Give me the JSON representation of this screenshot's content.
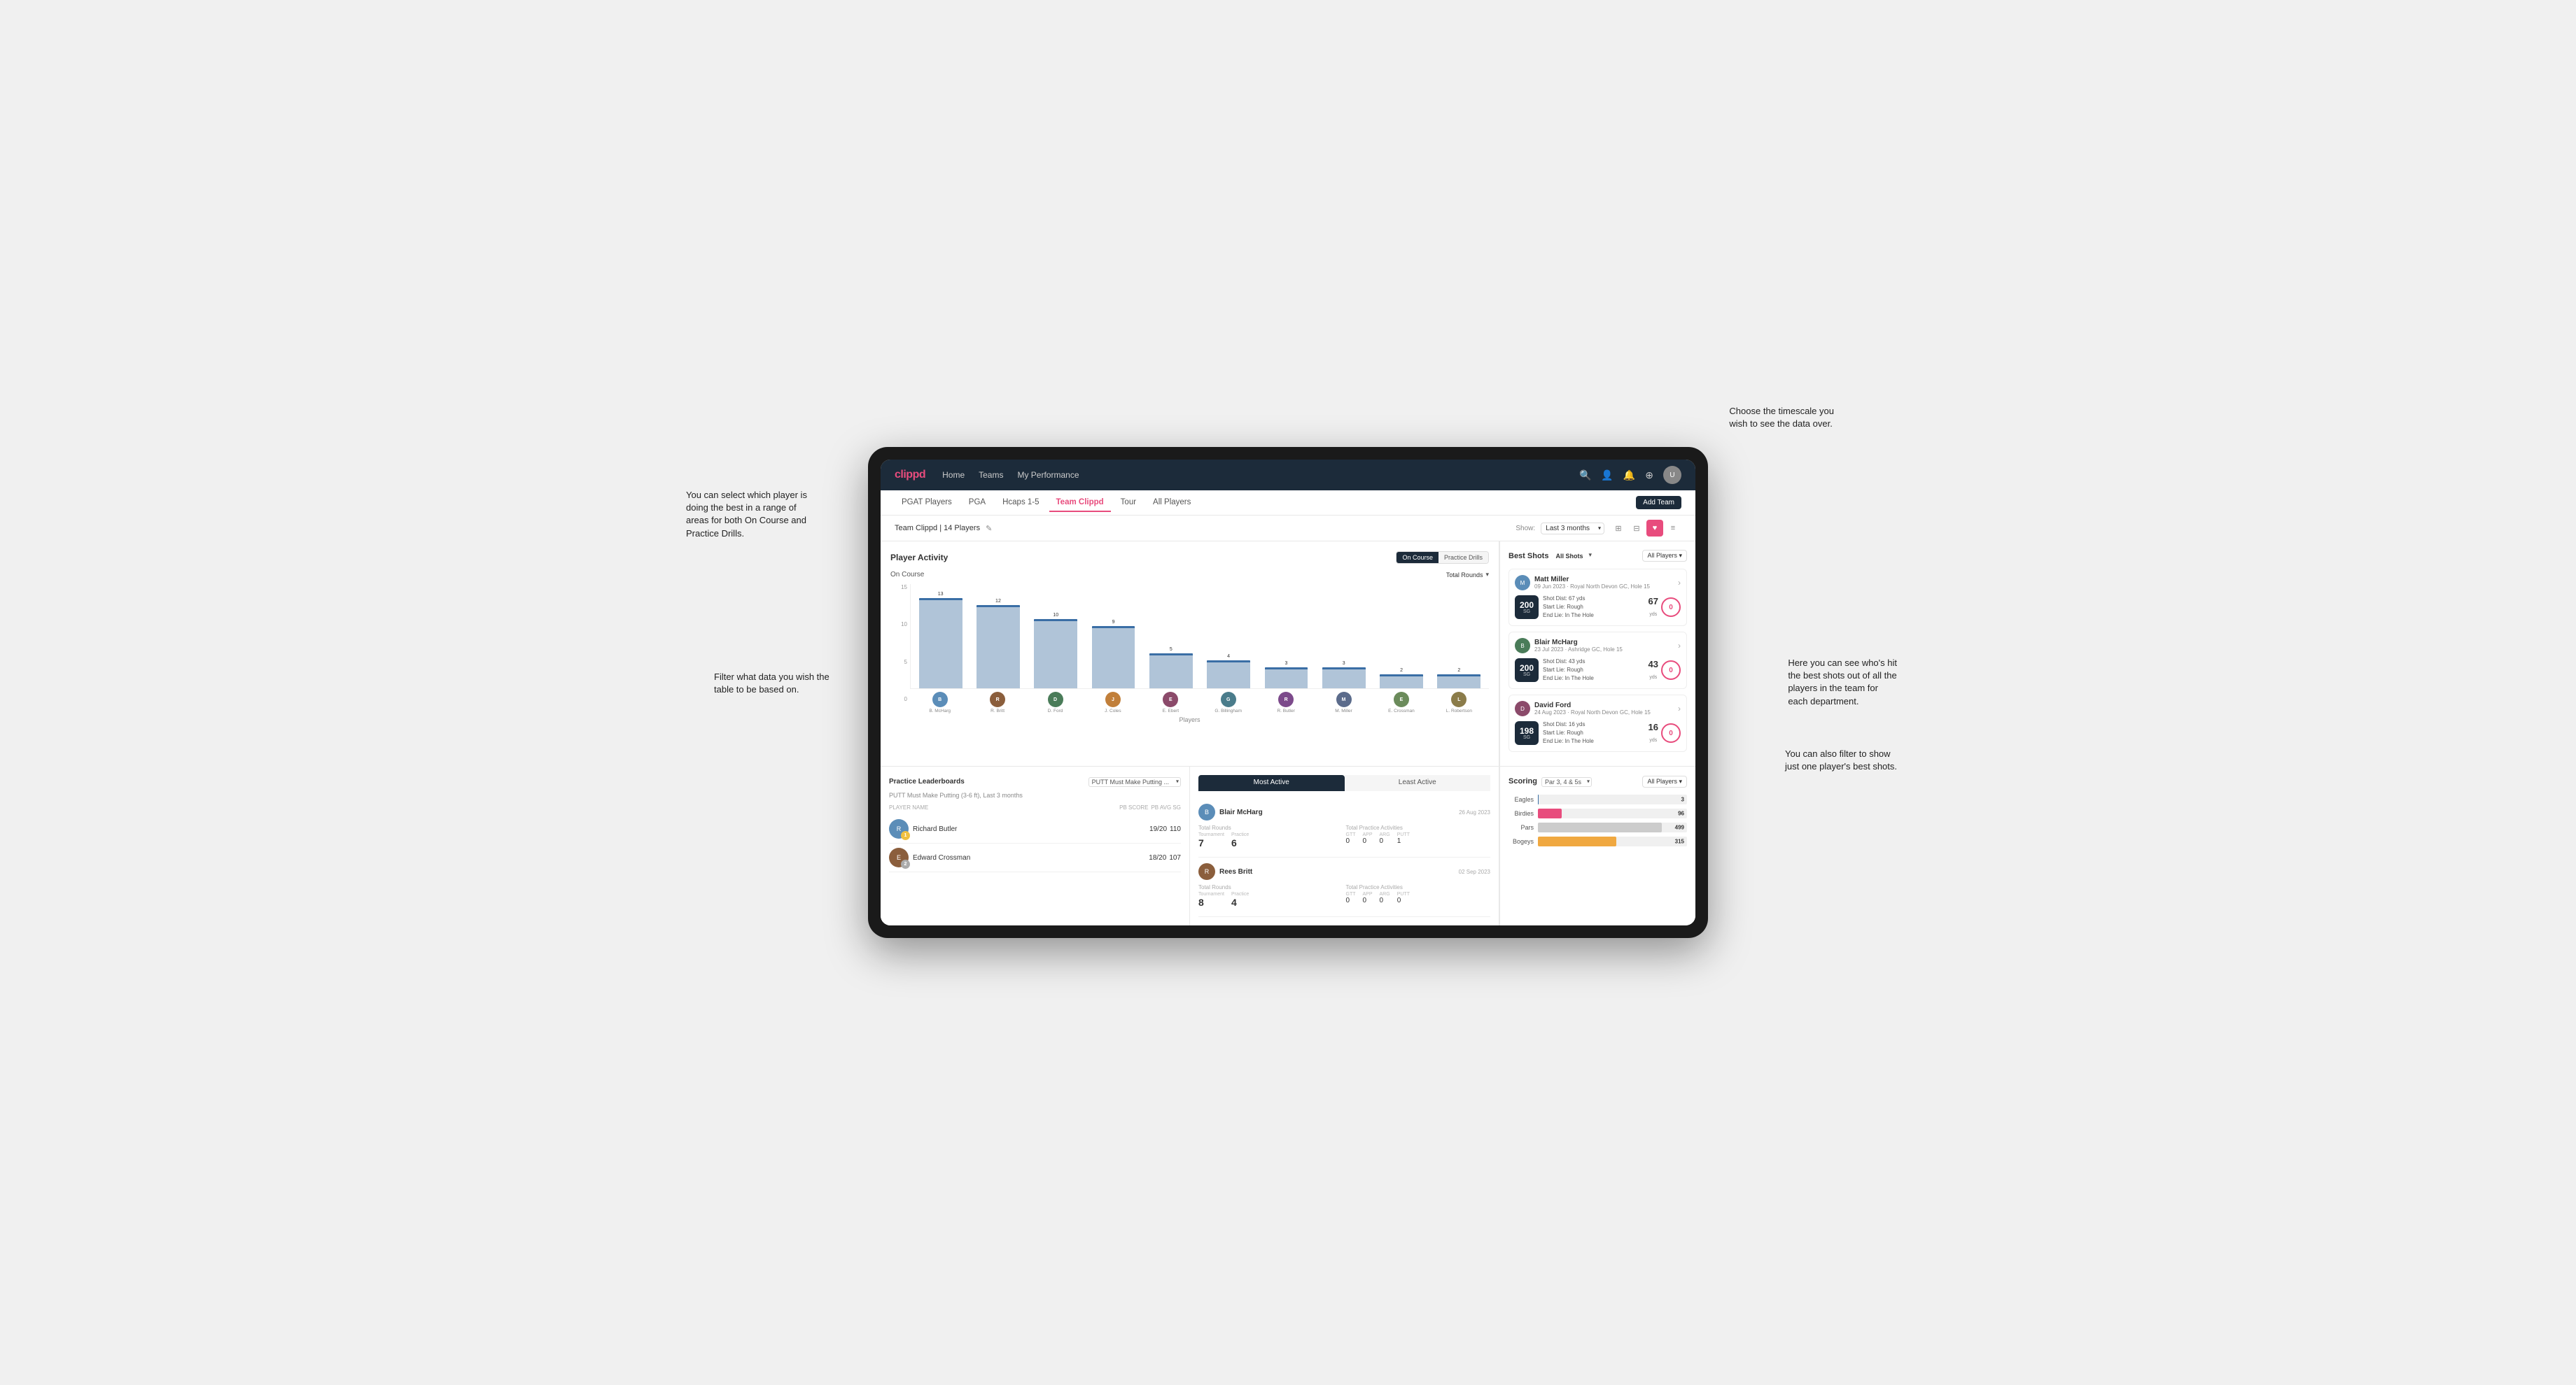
{
  "annotations": {
    "top_right": "Choose the timescale you\nwish to see the data over.",
    "left_top": "You can select which player is\ndoing the best in a range of\nareas for both On Course and\nPractice Drills.",
    "left_bottom": "Filter what data you wish the\ntable to be based on.",
    "right_mid": "Here you can see who's hit\nthe best shots out of all the\nplayers in the team for\neach department.",
    "right_bottom": "You can also filter to show\njust one player's best shots."
  },
  "navbar": {
    "brand": "clippd",
    "links": [
      "Home",
      "Teams",
      "My Performance"
    ]
  },
  "sub_tabs": {
    "items": [
      "PGAT Players",
      "PGA",
      "Hcaps 1-5",
      "Team Clippd",
      "Tour",
      "All Players"
    ],
    "active": "Team Clippd",
    "add_button": "Add Team"
  },
  "team_header": {
    "name": "Team Clippd | 14 Players",
    "show_label": "Show:",
    "show_value": "Last 3 months",
    "view_icons": [
      "grid4",
      "grid2",
      "heart",
      "list"
    ]
  },
  "player_activity": {
    "title": "Player Activity",
    "toggle": [
      "On Course",
      "Practice Drills"
    ],
    "active_toggle": "On Course",
    "section_label": "On Course",
    "dropdown": "Total Rounds",
    "x_axis_label": "Players",
    "y_labels": [
      "15",
      "10",
      "5",
      "0"
    ],
    "bars": [
      {
        "name": "B. McHarg",
        "value": 13,
        "color": "#b0c4d8"
      },
      {
        "name": "R. Britt",
        "value": 12,
        "color": "#b0c4d8"
      },
      {
        "name": "D. Ford",
        "value": 10,
        "color": "#b0c4d8"
      },
      {
        "name": "J. Coles",
        "value": 9,
        "color": "#b0c4d8"
      },
      {
        "name": "E. Ebert",
        "value": 5,
        "color": "#b0c4d8"
      },
      {
        "name": "G. Billingham",
        "value": 4,
        "color": "#b0c4d8"
      },
      {
        "name": "R. Butler",
        "value": 3,
        "color": "#b0c4d8"
      },
      {
        "name": "M. Miller",
        "value": 3,
        "color": "#b0c4d8"
      },
      {
        "name": "E. Crossman",
        "value": 2,
        "color": "#b0c4d8"
      },
      {
        "name": "L. Robertson",
        "value": 2,
        "color": "#b0c4d8"
      }
    ],
    "avatar_colors": [
      "#5b8db8",
      "#8b5e3c",
      "#4a7c59",
      "#c17f3a",
      "#8b4a6a",
      "#4a7c8b",
      "#7c4a8b",
      "#5b6b8b",
      "#6b8b5b",
      "#8b7c4a"
    ]
  },
  "best_shots": {
    "title": "Best Shots",
    "tabs": [
      "All Shots",
      "All Players"
    ],
    "players_filter": "All Players",
    "shots": [
      {
        "player_name": "Matt Miller",
        "player_meta": "09 Jun 2023 · Royal North Devon GC, Hole 15",
        "score": "200",
        "score_label": "SG",
        "details": "Shot Dist: 67 yds\nStart Lie: Rough\nEnd Lie: In The Hole",
        "stat1_value": "67",
        "stat1_unit": "yds",
        "stat2_value": "0",
        "stat2_unit": "yds"
      },
      {
        "player_name": "Blair McHarg",
        "player_meta": "23 Jul 2023 · Ashridge GC, Hole 15",
        "score": "200",
        "score_label": "SG",
        "details": "Shot Dist: 43 yds\nStart Lie: Rough\nEnd Lie: In The Hole",
        "stat1_value": "43",
        "stat1_unit": "yds",
        "stat2_value": "0",
        "stat2_unit": "yds"
      },
      {
        "player_name": "David Ford",
        "player_meta": "24 Aug 2023 · Royal North Devon GC, Hole 15",
        "score": "198",
        "score_label": "SG",
        "details": "Shot Dist: 16 yds\nStart Lie: Rough\nEnd Lie: In The Hole",
        "stat1_value": "16",
        "stat1_unit": "yds",
        "stat2_value": "0",
        "stat2_unit": "yds"
      }
    ]
  },
  "leaderboards": {
    "title": "Practice Leaderboards",
    "dropdown": "PUTT Must Make Putting ...",
    "subtitle": "PUTT Must Make Putting (3-6 ft), Last 3 months",
    "columns": [
      "PLAYER NAME",
      "PB SCORE",
      "PB AVG SG"
    ],
    "rows": [
      {
        "name": "Richard Butler",
        "rank": "1",
        "rank_color": "#f0c040",
        "pb_score": "19/20",
        "pb_avg": "110",
        "avatar_color": "#5b8db8"
      },
      {
        "name": "Edward Crossman",
        "rank": "2",
        "rank_color": "#aaa",
        "pb_score": "18/20",
        "pb_avg": "107",
        "avatar_color": "#8b5e3c"
      }
    ]
  },
  "most_active": {
    "tabs": [
      "Most Active",
      "Least Active"
    ],
    "active_tab": "Most Active",
    "players": [
      {
        "name": "Blair McHarg",
        "date": "26 Aug 2023",
        "total_rounds_label": "Total Rounds",
        "tournament_label": "Tournament",
        "practice_label": "Practice",
        "tournament_value": "7",
        "practice_value": "6",
        "total_practice_label": "Total Practice Activities",
        "gtt_label": "GTT",
        "app_label": "APP",
        "arg_label": "ARG",
        "putt_label": "PUTT",
        "gtt_value": "0",
        "app_value": "0",
        "arg_value": "0",
        "putt_value": "1",
        "avatar_color": "#5b8db8"
      },
      {
        "name": "Rees Britt",
        "date": "02 Sep 2023",
        "total_rounds_label": "Total Rounds",
        "tournament_label": "Tournament",
        "practice_label": "Practice",
        "tournament_value": "8",
        "practice_value": "4",
        "total_practice_label": "Total Practice Activities",
        "gtt_label": "GTT",
        "app_label": "APP",
        "arg_label": "ARG",
        "putt_label": "PUTT",
        "gtt_value": "0",
        "app_value": "0",
        "arg_value": "0",
        "putt_value": "0",
        "avatar_color": "#8b5e3c"
      }
    ]
  },
  "scoring": {
    "title": "Scoring",
    "dropdown_label": "Par 3, 4 & 5s",
    "filter_label": "All Players",
    "rows": [
      {
        "label": "Eagles",
        "value": 3,
        "max": 600,
        "color": "#3a6ea5"
      },
      {
        "label": "Birdies",
        "value": 96,
        "max": 600,
        "color": "#e84c7d"
      },
      {
        "label": "Pars",
        "value": 499,
        "max": 600,
        "color": "#ccc"
      },
      {
        "label": "Bogeys",
        "value": 315,
        "max": 600,
        "color": "#f0a840"
      }
    ]
  }
}
